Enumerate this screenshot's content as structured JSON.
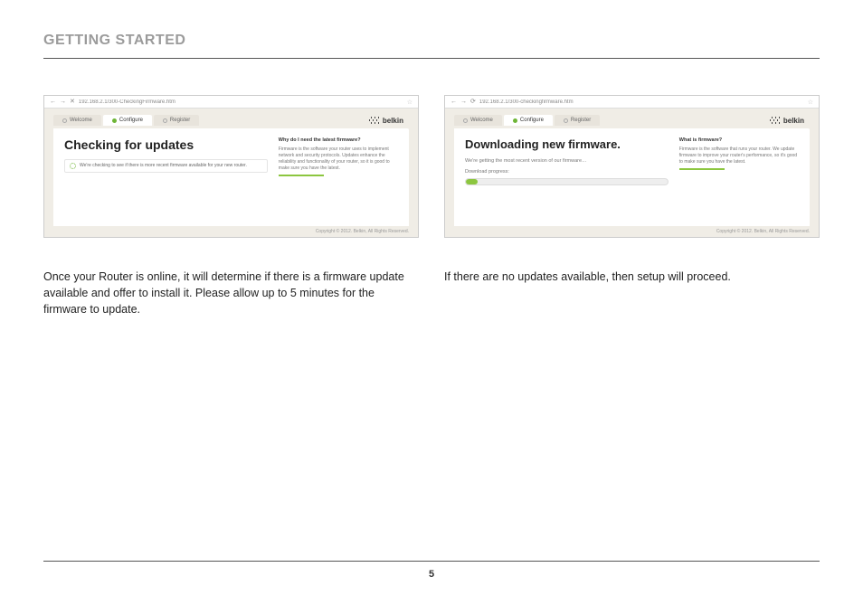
{
  "page": {
    "section_title": "GETTING STARTED",
    "page_number": "5"
  },
  "left": {
    "browser": {
      "address": "192.168.2.1/300-CheckingFirmware.htm"
    },
    "tabs": {
      "welcome": "Welcome",
      "configure": "Configure",
      "register": "Register"
    },
    "brand": "belkin",
    "card": {
      "heading": "Checking for updates",
      "check_text": "We're checking to see if there is more recent firmware available for your new router.",
      "side_heading": "Why do I need the latest firmware?",
      "side_body": "Firmware is the software your router uses to implement network and security protocols. Updates enhance the reliability and functionality of your router, so it is good to make sure you have the latest."
    },
    "copyright": "Copyright © 2012. Belkin, All Rights Reserved.",
    "caption": "Once your Router is online, it will determine if there is a firmware update available and offer to install it. Please allow up to 5 minutes for the firmware to update."
  },
  "right": {
    "browser": {
      "address": "192.168.2.1/300-checkingfirmware.htm"
    },
    "tabs": {
      "welcome": "Welcome",
      "configure": "Configure",
      "register": "Register"
    },
    "brand": "belkin",
    "card": {
      "heading": "Downloading new firmware.",
      "sub": "We're getting the most recent version of our firmware…",
      "progress_label": "Download progress:",
      "side_heading": "What is firmware?",
      "side_body": "Firmware is the software that runs your router. We update firmware to improve your router's performance, so it's good to make sure you have the latest."
    },
    "copyright": "Copyright © 2012. Belkin, All Rights Reserved.",
    "caption": "If there are no updates available, then setup will proceed."
  }
}
